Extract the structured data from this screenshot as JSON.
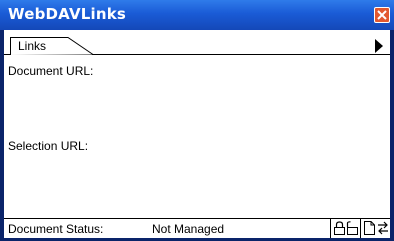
{
  "window": {
    "title": "WebDAVLinks"
  },
  "tabs": [
    {
      "label": "Links"
    }
  ],
  "panel": {
    "document_url_label": "Document URL:",
    "selection_url_label": "Selection URL:"
  },
  "status": {
    "label": "Document Status:",
    "value": "Not Managed"
  },
  "icons": {
    "close": "close-icon",
    "flyout": "flyout-menu-icon",
    "lock": "lock-icon",
    "unlock": "unlock-icon",
    "document": "document-icon",
    "sync": "sync-icon"
  },
  "colors": {
    "titlebar": "#1a5bd6",
    "border": "#0A246A",
    "close": "#e2582f"
  }
}
